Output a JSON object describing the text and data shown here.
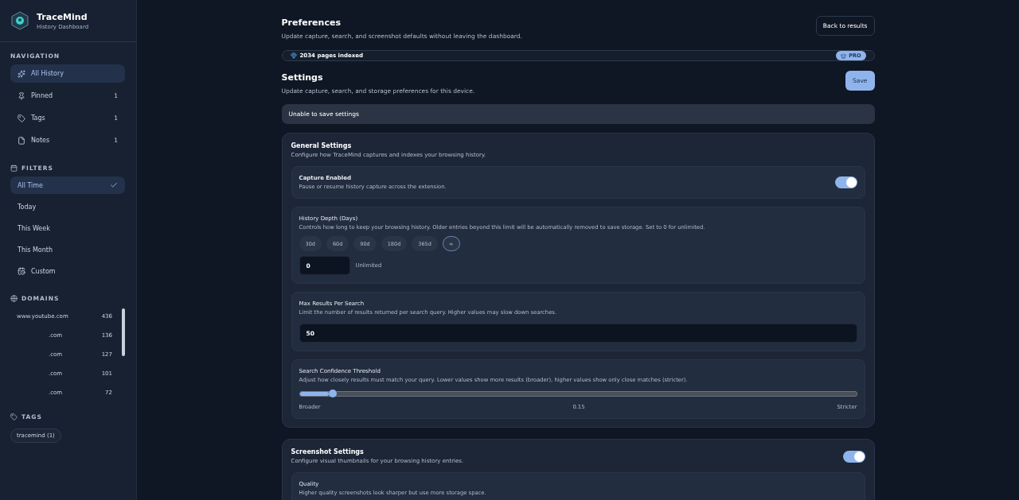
{
  "brand": {
    "name": "TraceMind",
    "subtitle": "History Dashboard"
  },
  "sidebar": {
    "navigation": {
      "heading": "NAVIGATION",
      "items": [
        {
          "label": "All History",
          "selected": true
        },
        {
          "label": "Pinned",
          "count": "1",
          "selected": false
        },
        {
          "label": "Tags",
          "count": "1",
          "selected": false
        },
        {
          "label": "Notes",
          "count": "1",
          "selected": false
        }
      ]
    },
    "filters": {
      "heading": "FILTERS",
      "items": [
        {
          "label": "All Time",
          "selected": true
        },
        {
          "label": "Today",
          "selected": false
        },
        {
          "label": "This Week",
          "selected": false
        },
        {
          "label": "This Month",
          "selected": false
        },
        {
          "label": "Custom",
          "selected": false
        }
      ]
    },
    "domains": {
      "heading": "DOMAINS",
      "items": [
        {
          "name": "www.youtube.com",
          "count": "436",
          "masked": false
        },
        {
          "name": ".com",
          "count": "136",
          "masked": true
        },
        {
          "name": ".com",
          "count": "127",
          "masked": true
        },
        {
          "name": ".com",
          "count": "101",
          "masked": true
        },
        {
          "name": ".com",
          "count": "72",
          "masked": true
        }
      ]
    },
    "tags": {
      "heading": "TAGS",
      "items": [
        "tracemind (1)"
      ]
    }
  },
  "header": {
    "title": "Preferences",
    "subtitle": "Update capture, search, and screenshot defaults without leaving the dashboard.",
    "back_button": "Back to results"
  },
  "index_bar": {
    "text": "2034 pages indexed",
    "badge": "PRO"
  },
  "settings": {
    "title": "Settings",
    "subtitle": "Update capture, search, and storage preferences for this device.",
    "save_button": "Save",
    "error": "Unable to save settings"
  },
  "sections": [
    {
      "title": "General Settings",
      "subtitle": "Configure how TraceMind captures and indexes your browsing history.",
      "rows": [
        {
          "kind": "toggle",
          "title": "Capture Enabled",
          "description": "Pause or resume history capture across the extension.",
          "on": true
        },
        {
          "kind": "presets",
          "title": "History Depth (Days)",
          "description": "Controls how long to keep your browsing history. Older entries beyond this limit will be automatically removed to save storage. Set to 0 for unlimited.",
          "presets": [
            {
              "label": "30d",
              "selected": false
            },
            {
              "label": "60d",
              "selected": false
            },
            {
              "label": "90d",
              "selected": false
            },
            {
              "label": "180d",
              "selected": false
            },
            {
              "label": "365d",
              "selected": false
            },
            {
              "label": "∞",
              "selected": true
            }
          ],
          "value": "0",
          "note": "Unlimited"
        },
        {
          "kind": "input",
          "title": "Max Results Per Search",
          "description": "Limit the number of results returned per search query. Higher values may slow down searches.",
          "value": "50"
        },
        {
          "kind": "slider",
          "title": "Search Confidence Threshold",
          "description": "Adjust how closely results must match your query. Lower values show more results (broader), higher values show only close matches (stricter).",
          "level": 0.06,
          "min_label": "Broader",
          "reading": "0.15",
          "max_label": "Stricter"
        }
      ]
    },
    {
      "title": "Screenshot Settings",
      "subtitle": "Configure visual thumbnails for your browsing history entries.",
      "on": true,
      "rows": [
        {
          "kind": "text",
          "title": "Quality",
          "description": "Higher quality screenshots look sharper but use more storage space."
        }
      ]
    }
  ]
}
